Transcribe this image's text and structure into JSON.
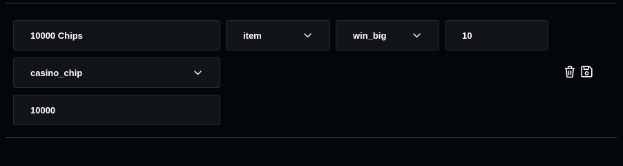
{
  "row1": {
    "name_value": "10000 Chips",
    "type_value": "item",
    "trigger_value": "win_big",
    "amount_value": "10"
  },
  "row2": {
    "item_value": "casino_chip"
  },
  "row3": {
    "quantity_value": "10000"
  },
  "icons": {
    "chevron": "chevron-down-icon",
    "delete": "trash-icon",
    "save": "save-icon"
  },
  "colors": {
    "background": "#03070c",
    "field_bg": "#111519",
    "field_border": "#252a30",
    "text": "#ffffff",
    "divider": "#3a3f46"
  }
}
